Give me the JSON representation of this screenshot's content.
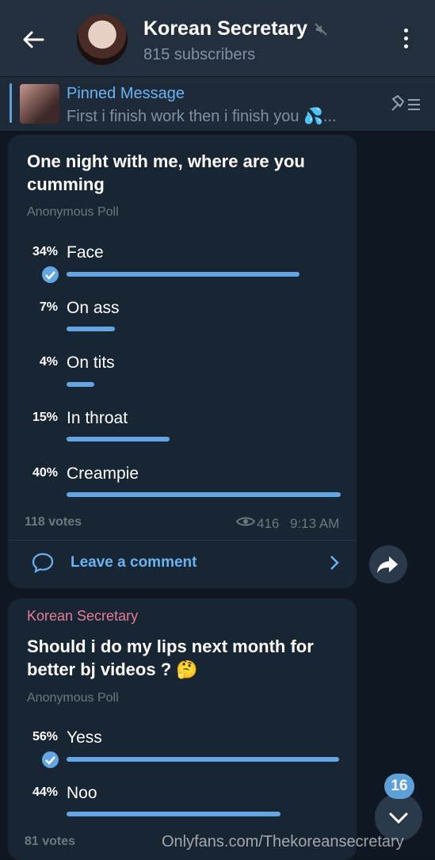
{
  "header": {
    "title": "Korean Secretary",
    "subtitle": "815 subscribers"
  },
  "pinned": {
    "title": "Pinned Message",
    "text": "First i finish work then i finish you 💦..."
  },
  "poll1": {
    "question": "One night with me, where are you cumming",
    "type": "Anonymous Poll",
    "options": [
      {
        "percent": "34%",
        "label": "Face",
        "fraction": 0.34,
        "selected": true
      },
      {
        "percent": "7%",
        "label": "On ass",
        "fraction": 0.07,
        "selected": false
      },
      {
        "percent": "4%",
        "label": "On tits",
        "fraction": 0.04,
        "selected": false
      },
      {
        "percent": "15%",
        "label": "In throat",
        "fraction": 0.15,
        "selected": false
      },
      {
        "percent": "40%",
        "label": "Creampie",
        "fraction": 0.4,
        "selected": false
      }
    ],
    "votes": "118 votes",
    "views": "416",
    "time": "9:13 AM",
    "comment": "Leave a comment"
  },
  "poll2": {
    "author": "Korean Secretary",
    "question": "Should i do my lips next month for better bj videos ? 🤔",
    "type": "Anonymous Poll",
    "options": [
      {
        "percent": "56%",
        "label": "Yess",
        "fraction": 0.56,
        "selected": true
      },
      {
        "percent": "44%",
        "label": "Noo",
        "fraction": 0.44,
        "selected": false
      }
    ],
    "votes": "81 votes"
  },
  "scroll_badge": "16",
  "watermark": "Onlyfans.com/Thekoreansecretary",
  "colors": {
    "header": "#242f3d",
    "bubble": "#182533",
    "accent": "#63a6e3",
    "author": "#e67a99"
  }
}
